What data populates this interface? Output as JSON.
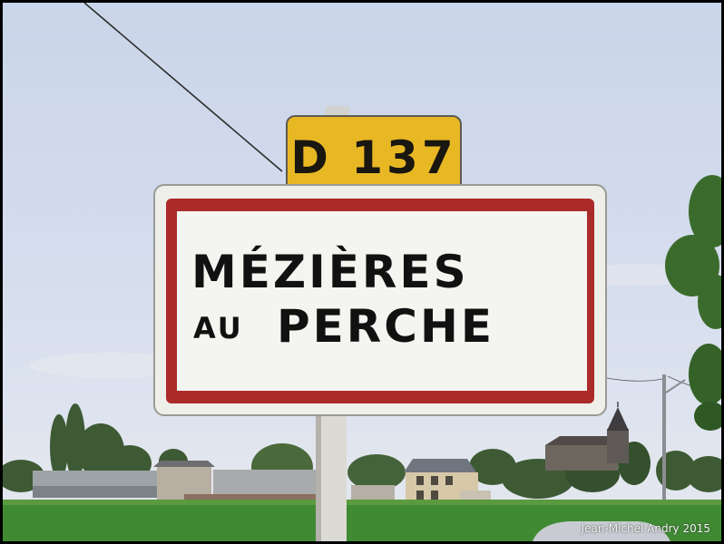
{
  "sign": {
    "route": "D 137",
    "line1": "MÉZIÈRES",
    "line2_small": "AU",
    "line2_big": "PERCHE"
  },
  "watermark": "Jean-Michel Andry 2015",
  "colors": {
    "sky": "#d2dbec",
    "field": "#3f8a33",
    "sign_red": "#ab2a2a",
    "sign_white": "#f4f4f0",
    "route_yellow": "#e8b824"
  }
}
